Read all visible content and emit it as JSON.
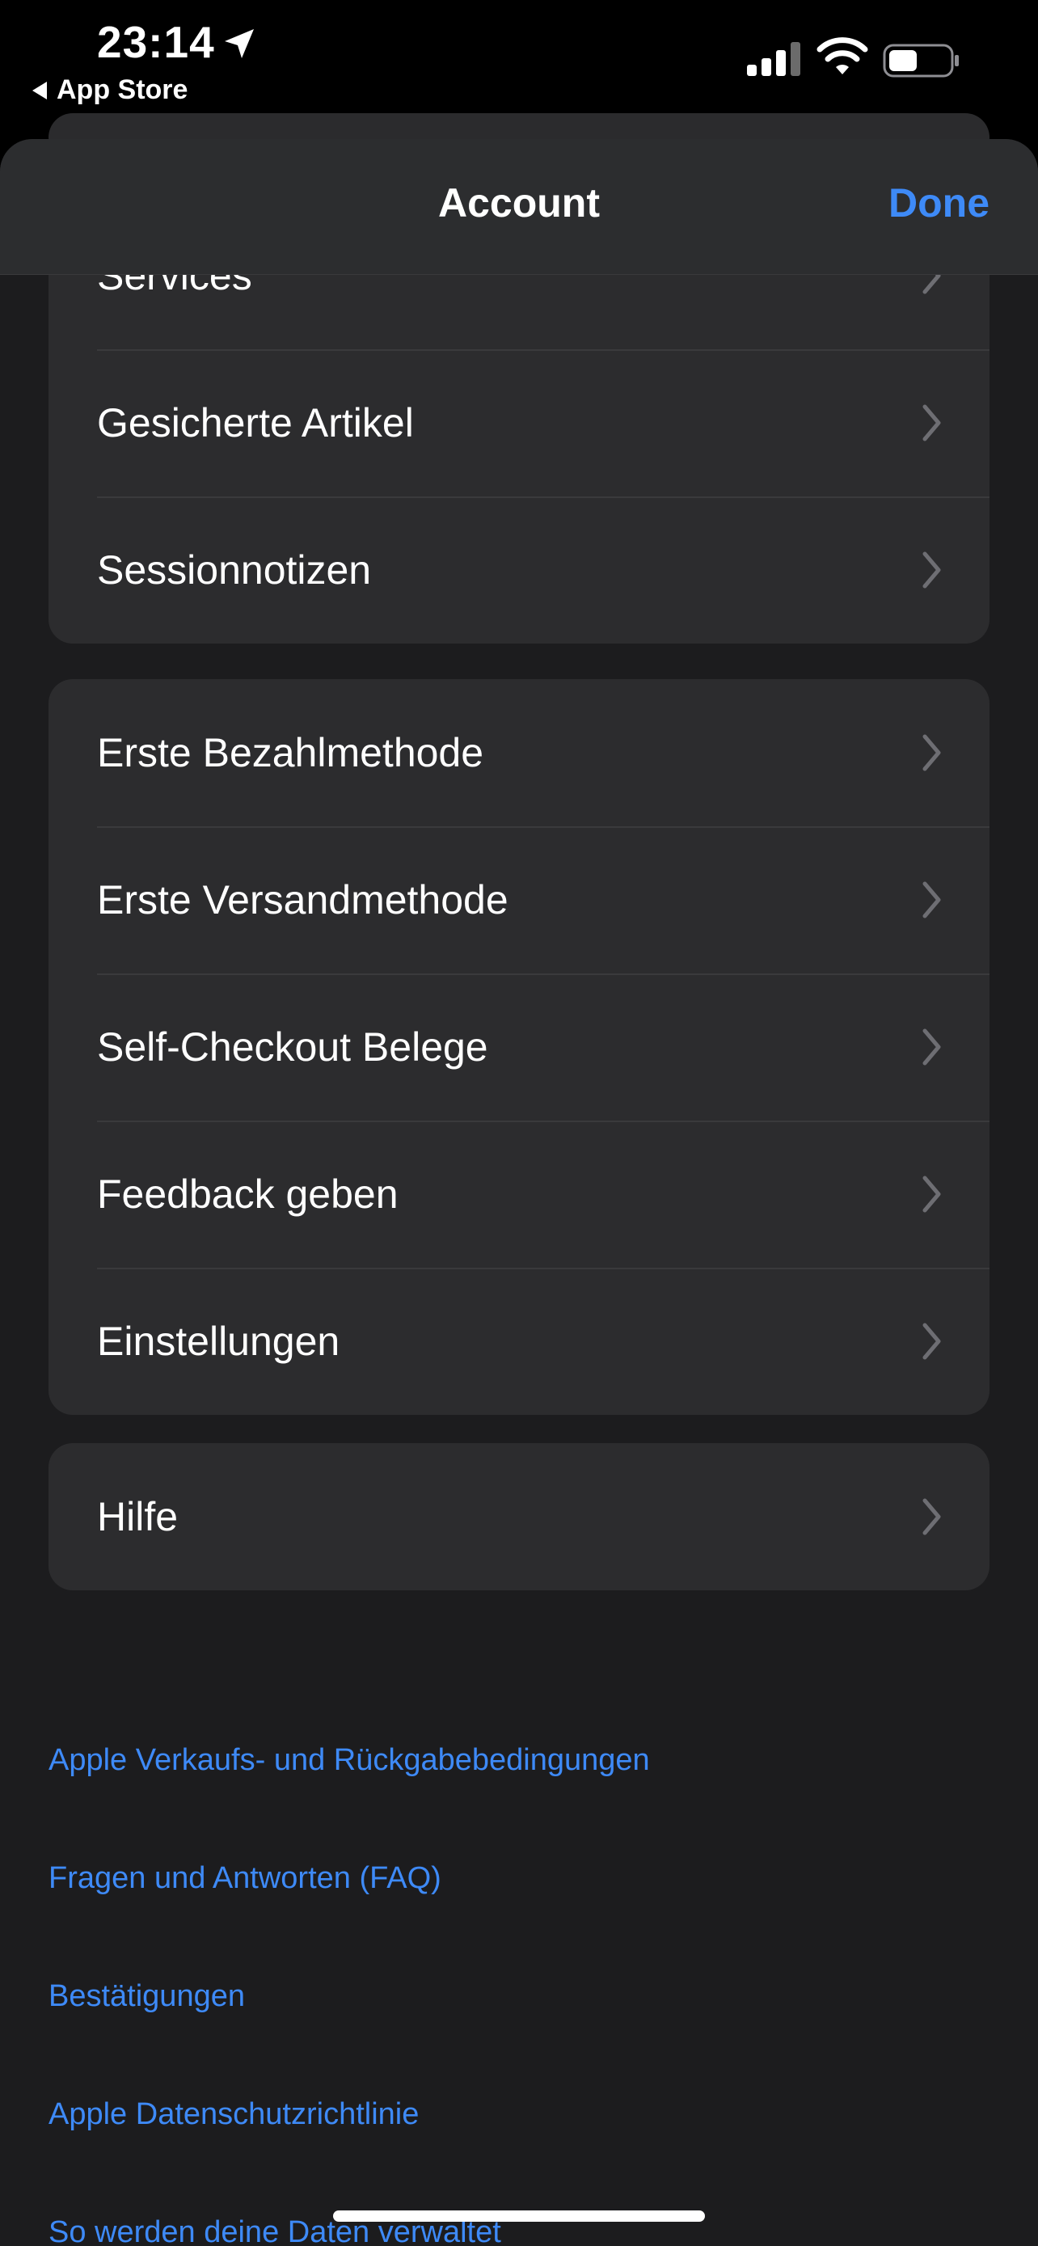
{
  "status_bar": {
    "time": "23:14",
    "back_app": "App Store",
    "icons": [
      "location-arrow-icon",
      "cellular-signal-icon",
      "wifi-icon",
      "battery-icon"
    ]
  },
  "nav": {
    "title": "Account",
    "done_label": "Done"
  },
  "groups": [
    {
      "items": [
        "Services",
        "Gesicherte Artikel",
        "Sessionnotizen"
      ]
    },
    {
      "items": [
        "Erste Bezahlmethode",
        "Erste Versandmethode",
        "Self-Checkout Belege",
        "Feedback geben",
        "Einstellungen"
      ]
    },
    {
      "items": [
        "Hilfe"
      ]
    }
  ],
  "footer_links": [
    "Apple Verkaufs- und Rückgabebedingungen",
    "Fragen und Antworten (FAQ)",
    "Bestätigungen",
    "Apple Datenschutzrichtlinie",
    "So werden deine Daten verwaltet"
  ],
  "colors": {
    "accent": "#3e8af7",
    "background": "#1c1c1e",
    "cell": "#2c2c2e"
  }
}
